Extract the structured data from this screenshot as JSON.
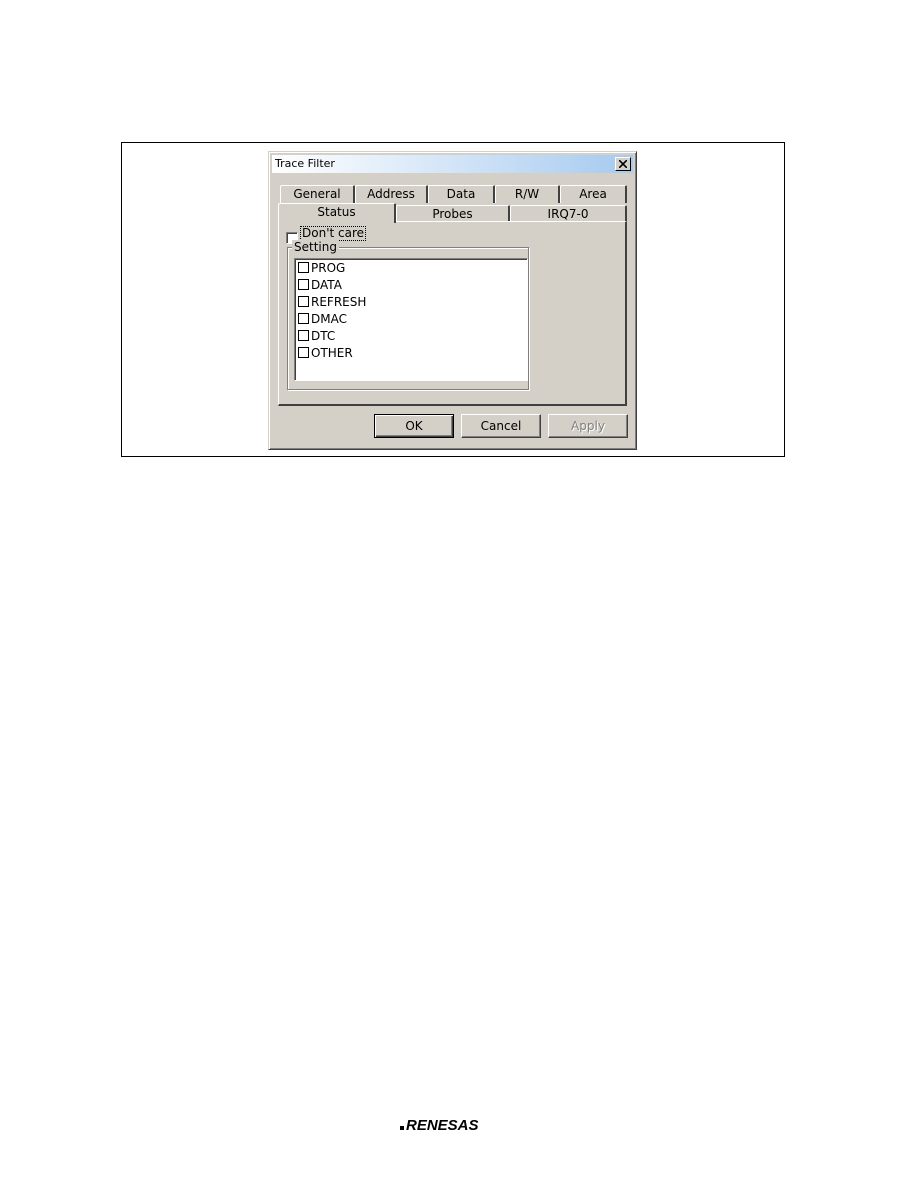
{
  "dialog": {
    "title": "Trace Filter",
    "tabs_row1": [
      "General",
      "Address",
      "Data",
      "R/W",
      "Area"
    ],
    "tabs_row2": [
      "Status",
      "Probes",
      "IRQ7-0"
    ],
    "active_tab": "Status",
    "dont_care": {
      "label": "Don't care",
      "checked": false
    },
    "setting": {
      "legend": "Setting",
      "items": [
        {
          "label": "PROG",
          "checked": false
        },
        {
          "label": "DATA",
          "checked": false
        },
        {
          "label": "REFRESH",
          "checked": false
        },
        {
          "label": "DMAC",
          "checked": false
        },
        {
          "label": "DTC",
          "checked": false
        },
        {
          "label": "OTHER",
          "checked": false
        }
      ]
    },
    "buttons": {
      "ok": "OK",
      "cancel": "Cancel",
      "apply": "Apply"
    }
  },
  "footer": {
    "logo_text": "RENESAS"
  }
}
